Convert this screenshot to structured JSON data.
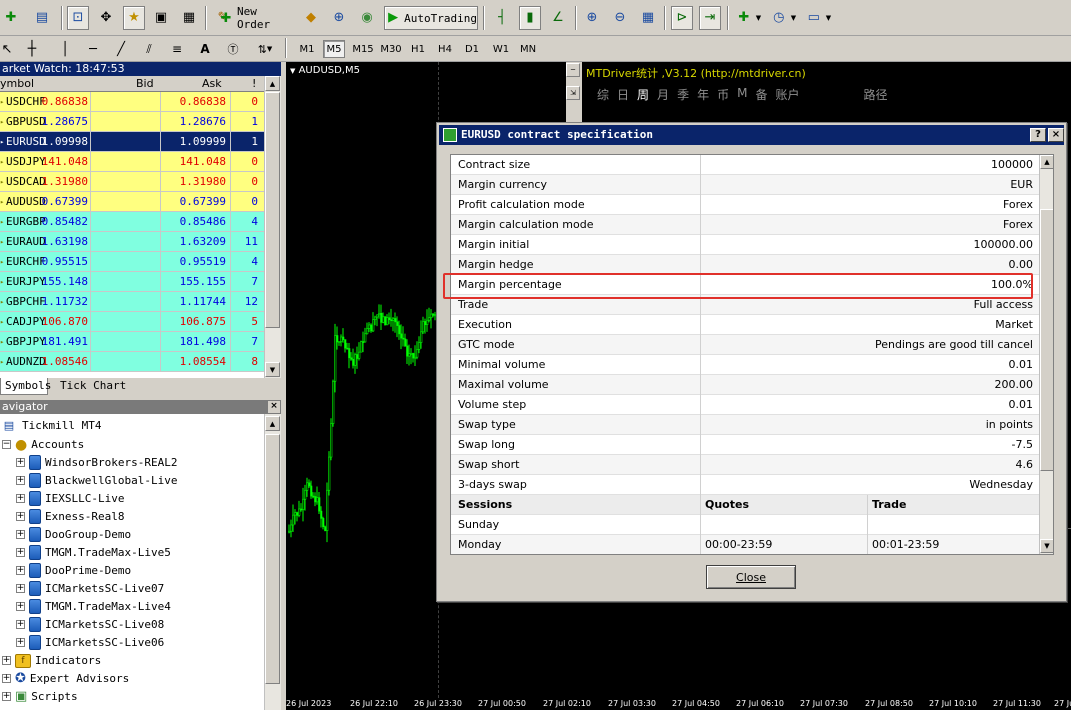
{
  "toolbar": {
    "new_order_label": "New Order",
    "autotrading_label": "AutoTrading",
    "timeframes": [
      "M1",
      "M5",
      "M15",
      "M30",
      "H1",
      "H4",
      "D1",
      "W1",
      "MN"
    ],
    "active_timeframe": "M5"
  },
  "market_watch": {
    "title": "arket Watch: 18:47:53",
    "col_symbol": "ymbol",
    "col_bid": "Bid",
    "col_ask": "Ask",
    "col_spread": "!",
    "rows": [
      {
        "symbol": "USDCHF",
        "bid": "0.86838",
        "ask": "0.86838",
        "spread": "0",
        "bg": "#ffff80",
        "color": "#e00000"
      },
      {
        "symbol": "GBPUSD",
        "bid": "1.28675",
        "ask": "1.28676",
        "spread": "1",
        "bg": "#ffff80",
        "color": "#0000e0"
      },
      {
        "symbol": "EURUSD",
        "bid": "1.09998",
        "ask": "1.09999",
        "spread": "1",
        "bg": "#0a246a",
        "color": "#ffffff"
      },
      {
        "symbol": "USDJPY",
        "bid": "141.048",
        "ask": "141.048",
        "spread": "0",
        "bg": "#ffff80",
        "color": "#e00000"
      },
      {
        "symbol": "USDCAD",
        "bid": "1.31980",
        "ask": "1.31980",
        "spread": "0",
        "bg": "#ffff80",
        "color": "#e00000"
      },
      {
        "symbol": "AUDUSD",
        "bid": "0.67399",
        "ask": "0.67399",
        "spread": "0",
        "bg": "#ffff80",
        "color": "#0000e0"
      },
      {
        "symbol": "EURGBP",
        "bid": "0.85482",
        "ask": "0.85486",
        "spread": "4",
        "bg": "#80ffe0",
        "color": "#0000e0"
      },
      {
        "symbol": "EURAUD",
        "bid": "1.63198",
        "ask": "1.63209",
        "spread": "11",
        "bg": "#80ffe0",
        "color": "#0000e0"
      },
      {
        "symbol": "EURCHF",
        "bid": "0.95515",
        "ask": "0.95519",
        "spread": "4",
        "bg": "#80ffe0",
        "color": "#0000e0"
      },
      {
        "symbol": "EURJPY",
        "bid": "155.148",
        "ask": "155.155",
        "spread": "7",
        "bg": "#80ffe0",
        "color": "#0000e0"
      },
      {
        "symbol": "GBPCHF",
        "bid": "1.11732",
        "ask": "1.11744",
        "spread": "12",
        "bg": "#80ffe0",
        "color": "#0000e0"
      },
      {
        "symbol": "CADJPY",
        "bid": "106.870",
        "ask": "106.875",
        "spread": "5",
        "bg": "#80ffe0",
        "color": "#e00000"
      },
      {
        "symbol": "GBPJPY",
        "bid": "181.491",
        "ask": "181.498",
        "spread": "7",
        "bg": "#80ffe0",
        "color": "#0000e0"
      },
      {
        "symbol": "AUDNZD",
        "bid": "1.08546",
        "ask": "1.08554",
        "spread": "8",
        "bg": "#80ffe0",
        "color": "#e00000"
      }
    ],
    "tabs": [
      "Symbols",
      "Tick Chart"
    ]
  },
  "navigator": {
    "title": "avigator",
    "root": "Tickmill MT4",
    "accounts_label": "Accounts",
    "accounts": [
      "WindsorBrokers-REAL2",
      "BlackwellGlobal-Live",
      "IEXSLLC-Live",
      "Exness-Real8",
      "DooGroup-Demo",
      "TMGM.TradeMax-Live5",
      "DooPrime-Demo",
      "ICMarketsSC-Live07",
      "TMGM.TradeMax-Live4",
      "ICMarketsSC-Live08",
      "ICMarketsSC-Live06"
    ],
    "indicators_label": "Indicators",
    "experts_label": "Expert Advisors",
    "scripts_label": "Scripts"
  },
  "chart": {
    "title": "AUDUSD,M5",
    "mtdriver_title": "MTDriver统计 ,V3.12 (http://mtdriver.cn)",
    "mtdriver_menu": [
      "综",
      "日",
      "周",
      "月",
      "季",
      "年",
      "币",
      "M",
      "备",
      "账户",
      "路径"
    ],
    "time_labels": [
      "26 Jul 2023",
      "26 Jul 22:10",
      "26 Jul 23:30",
      "27 Jul 00:50",
      "27 Jul 02:10",
      "27 Jul 03:30",
      "27 Jul 04:50",
      "27 Jul 06:10",
      "27 Jul 07:30",
      "27 Jul 08:50",
      "27 Jul 10:10",
      "27 Jul 11:30",
      "27 Jul 1"
    ]
  },
  "dialog": {
    "title": "EURUSD contract specification",
    "help_label": "?",
    "close_x": "×",
    "spec_rows": [
      {
        "key": "Contract size",
        "value": "100000"
      },
      {
        "key": "Margin currency",
        "value": "EUR"
      },
      {
        "key": "Profit calculation mode",
        "value": "Forex"
      },
      {
        "key": "Margin calculation mode",
        "value": "Forex"
      },
      {
        "key": "Margin initial",
        "value": "100000.00"
      },
      {
        "key": "Margin hedge",
        "value": "0.00"
      },
      {
        "key": "Margin percentage",
        "value": "100.0%"
      },
      {
        "key": "Trade",
        "value": "Full access"
      },
      {
        "key": "Execution",
        "value": "Market"
      },
      {
        "key": "GTC mode",
        "value": "Pendings are good till cancel"
      },
      {
        "key": "Minimal volume",
        "value": "0.01"
      },
      {
        "key": "Maximal volume",
        "value": "200.00"
      },
      {
        "key": "Volume step",
        "value": "0.01"
      },
      {
        "key": "Swap type",
        "value": "in points"
      },
      {
        "key": "Swap long",
        "value": "-7.5"
      },
      {
        "key": "Swap short",
        "value": "4.6"
      },
      {
        "key": "3-days swap",
        "value": "Wednesday"
      }
    ],
    "sessions_header": {
      "a": "Sessions",
      "b": "Quotes",
      "c": "Trade"
    },
    "session_rows": [
      {
        "day": "Sunday",
        "quotes": "",
        "trade": ""
      },
      {
        "day": "Monday",
        "quotes": "00:00-23:59",
        "trade": "00:01-23:59"
      }
    ],
    "close_label": "Close"
  }
}
